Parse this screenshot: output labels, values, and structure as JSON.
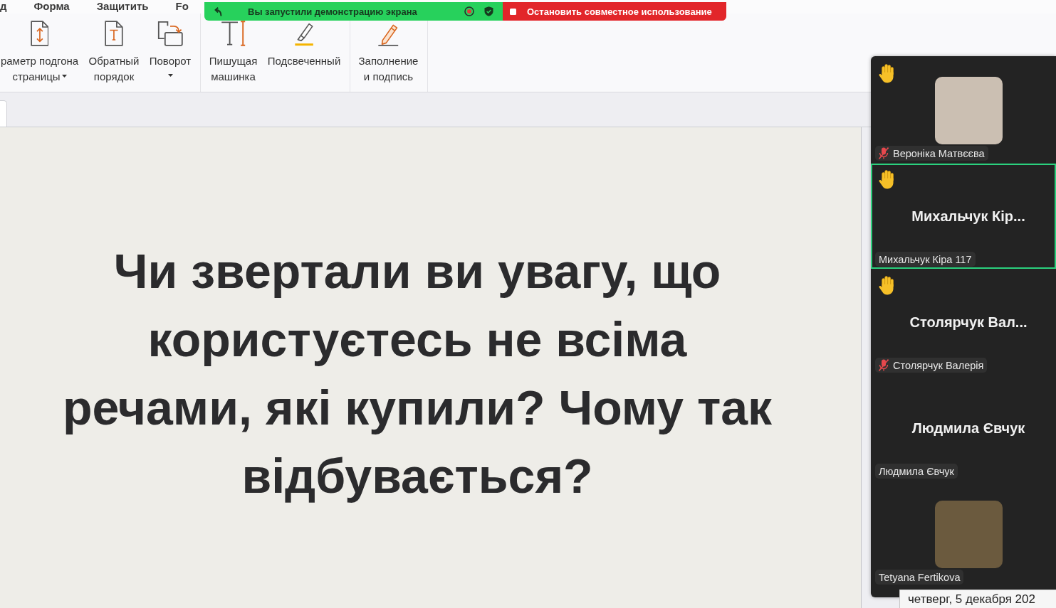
{
  "menu": [
    {
      "label": "д"
    },
    {
      "label": "Форма"
    },
    {
      "label": "Защитить"
    },
    {
      "label": "Fo"
    }
  ],
  "ribbon": [
    {
      "items": [
        {
          "kind": "fit-page",
          "label": "раметр подгона страницы",
          "dropdown": true
        },
        {
          "kind": "reverse-order",
          "label": "Обратный порядок",
          "dropdown": false
        },
        {
          "kind": "rotate",
          "label": "Поворот",
          "dropdown": true
        }
      ]
    },
    {
      "items": [
        {
          "kind": "typewriter",
          "label": "Пишущая машинка",
          "dropdown": false
        },
        {
          "kind": "highlight",
          "label": "Подсвеченный",
          "dropdown": false
        }
      ]
    },
    {
      "items": [
        {
          "kind": "fill-sign",
          "label": "Заполнение и подпись",
          "dropdown": false
        }
      ]
    }
  ],
  "slide": {
    "text": "Чи звертали ви увагу, що користуєтесь не всіма речами, які купили? Чому так відбувається?"
  },
  "share_bar": {
    "status": "Вы запустили демонстрацию экрана",
    "stop_button": "Остановить совместное использование"
  },
  "participants": [
    {
      "kind": "photo",
      "hand_raised": true,
      "muted": true,
      "speaking": false,
      "label": "Вероніка Матвєєва"
    },
    {
      "kind": "name",
      "display_name": "Михальчук Кір...",
      "hand_raised": true,
      "muted": false,
      "speaking": true,
      "label": "Михальчук Кіра 117"
    },
    {
      "kind": "name",
      "display_name": "Столярчук Вал...",
      "hand_raised": true,
      "muted": true,
      "speaking": false,
      "label": "Столярчук Валерія"
    },
    {
      "kind": "name",
      "display_name": "Людмила Євчук",
      "hand_raised": false,
      "muted": false,
      "speaking": false,
      "label": "Людмила Євчук"
    },
    {
      "kind": "photo",
      "hand_raised": false,
      "muted": false,
      "speaking": false,
      "label": "Tetyana Fertikova"
    }
  ],
  "tooltip": {
    "text": "четверг, 5 декабря 202"
  }
}
